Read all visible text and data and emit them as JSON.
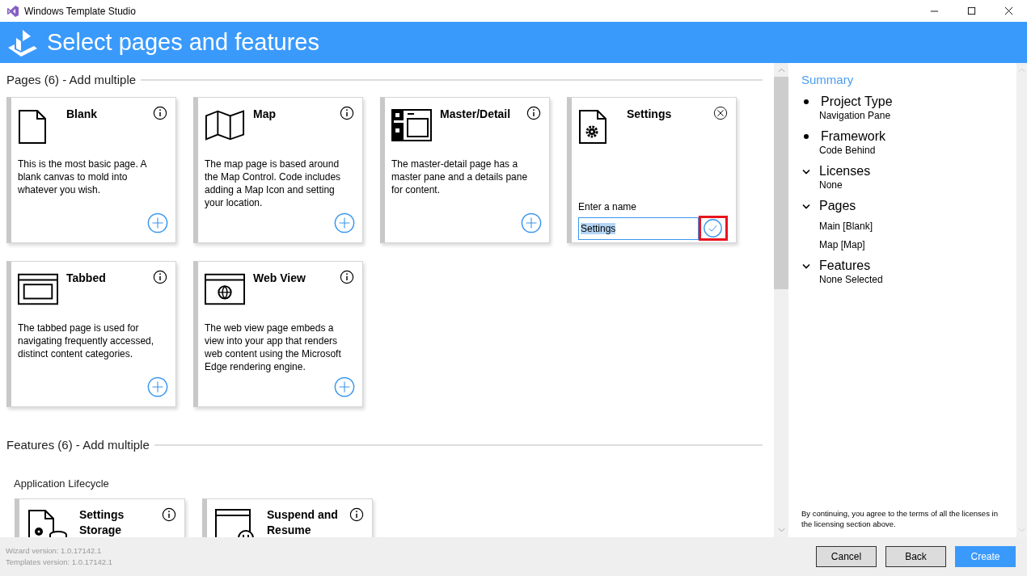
{
  "window": {
    "title": "Windows Template Studio"
  },
  "header": {
    "title": "Select pages and features"
  },
  "pages_section": {
    "heading": "Pages (6) - Add multiple",
    "cards": [
      {
        "kind": "template",
        "title": "Blank",
        "description": "This is the most basic page. A blank canvas to mold into whatever you wish."
      },
      {
        "kind": "template",
        "title": "Map",
        "description": "The map page is based around the Map Control. Code includes adding a Map Icon and setting your location."
      },
      {
        "kind": "template",
        "title": "Master/Detail",
        "description": "The master-detail page has a master pane and a details pane for content."
      },
      {
        "kind": "naming",
        "title": "Settings",
        "name_label": "Enter a name",
        "name_value": "Settings",
        "confirm_highlighted": true
      },
      {
        "kind": "template",
        "title": "Tabbed",
        "description": "The tabbed page is used for navigating frequently accessed, distinct content categories."
      },
      {
        "kind": "template",
        "title": "Web View",
        "description": "The web view page embeds a view into your app that renders web content using the Microsoft Edge rendering engine."
      }
    ]
  },
  "features_section": {
    "heading": "Features (6) - Add multiple",
    "group": "Application Lifecycle",
    "cards": [
      {
        "title": "Settings Storage"
      },
      {
        "title": "Suspend and Resume"
      }
    ]
  },
  "summary": {
    "heading": "Summary",
    "items": [
      {
        "kind": "bullet",
        "title": "Project Type",
        "values": [
          "Navigation Pane"
        ]
      },
      {
        "kind": "bullet",
        "title": "Framework",
        "values": [
          "Code Behind"
        ]
      },
      {
        "kind": "collapsible",
        "expanded": true,
        "title": "Licenses",
        "values": [
          "None"
        ]
      },
      {
        "kind": "collapsible",
        "expanded": true,
        "title": "Pages",
        "values": [
          "Main [Blank]",
          "Map [Map]"
        ]
      },
      {
        "kind": "collapsible",
        "expanded": true,
        "title": "Features",
        "values": [
          "None Selected"
        ]
      }
    ],
    "footnote": "By continuing, you agree to the terms of all the licenses in the licensing section above."
  },
  "footer": {
    "versions": [
      "Wizard version: 1.0.17142.1",
      "Templates version: 1.0.17142.1"
    ],
    "buttons": [
      {
        "label": "Cancel",
        "primary": false
      },
      {
        "label": "Back",
        "primary": false
      },
      {
        "label": "Create",
        "primary": true
      }
    ]
  }
}
